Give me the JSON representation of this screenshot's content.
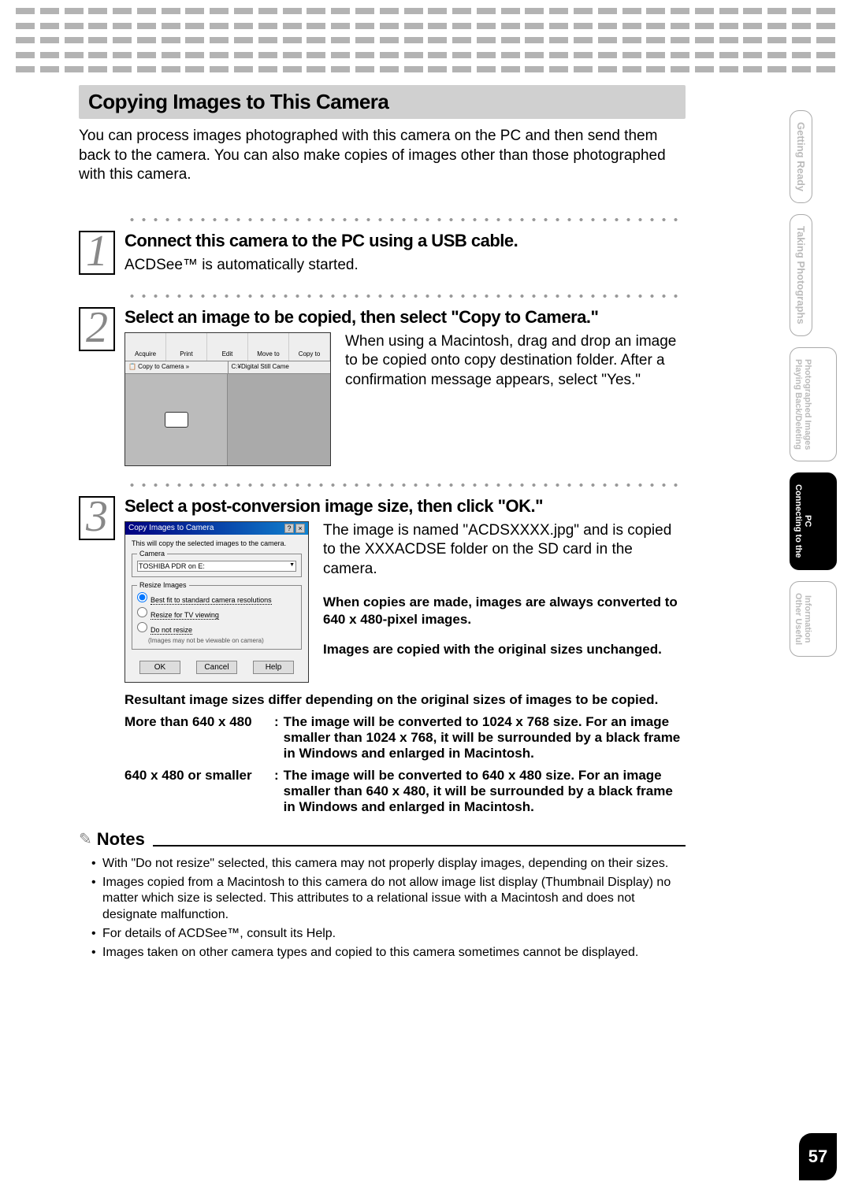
{
  "header": {
    "title": "Copying Images to This Camera",
    "intro": "You can process images photographed with this camera on the PC and then send them back to the camera. You can also make copies of images other than those photographed with this camera."
  },
  "steps": {
    "step1": {
      "num": "1",
      "title": "Connect this camera to the PC using a USB cable.",
      "desc": "ACDSee™ is automatically started."
    },
    "step2": {
      "num": "2",
      "title": "Select an image to be copied, then select \"Copy to Camera.\"",
      "desc": "When using a Macintosh, drag and drop an image to be copied onto copy destination folder. After a confirmation message appears, select \"Yes.\"",
      "ss": {
        "toolbar": [
          "Acquire",
          "Print",
          "Edit",
          "Move to",
          "Copy to"
        ],
        "copybar_left": "📋 Copy to Camera  »",
        "copybar_right": "C:¥Digital Still Came"
      }
    },
    "step3": {
      "num": "3",
      "title": "Select a post-conversion image size, then click \"OK.\"",
      "desc": "The image is named \"ACDSXXXX.jpg\" and is copied to the XXXACDSE folder on the SD card in the camera.",
      "bold1": "When copies are made, images are always converted to 640 x 480-pixel images.",
      "bold2": "Images are copied with the original sizes unchanged.",
      "dialog": {
        "title": "Copy Images to Camera",
        "msg": "This will copy the selected images to the camera.",
        "group_camera": "Camera",
        "camera_select": "TOSHIBA PDR          on E:",
        "group_resize": "Resize Images",
        "radio1": "Best fit to standard camera resolutions",
        "radio2": "Resize for TV viewing",
        "radio3": "Do not resize",
        "radio3_hint": "(Images may not be viewable on camera)",
        "btn_ok": "OK",
        "btn_cancel": "Cancel",
        "btn_help": "Help"
      },
      "result_header": "Resultant image sizes differ depending on the original sizes of images to be copied.",
      "result_rows": [
        {
          "label": "More than 640 x 480",
          "desc": "The image will be converted to 1024 x 768 size. For an image smaller than 1024 x 768, it will be surrounded by a black frame in Windows and enlarged in Macintosh."
        },
        {
          "label": "640 x 480 or smaller",
          "desc": "The image will be converted to 640 x 480 size. For an image smaller than 640 x 480, it will be surrounded by a black frame in Windows and enlarged in Macintosh."
        }
      ]
    }
  },
  "notes": {
    "title": "Notes",
    "items": [
      "With \"Do not resize\" selected, this camera may not properly display images, depending on their sizes.",
      "Images copied from a Macintosh to this camera do not allow image list display (Thumbnail Display) no matter which size is selected. This attributes to a relational issue with a Macintosh and does not designate malfunction.",
      "For details of ACDSee™, consult its Help.",
      "Images taken on other camera types and copied to this camera sometimes cannot be displayed."
    ]
  },
  "side": {
    "tabs": [
      "Getting Ready",
      "Taking Photographs"
    ],
    "tab_double1a": "Playing Back/Deleting",
    "tab_double1b": "Photographed Images",
    "tab_active_a": "Connecting to the",
    "tab_active_b": "PC",
    "tab_last_a": "Other Useful",
    "tab_last_b": "Information"
  },
  "page_number": "57"
}
